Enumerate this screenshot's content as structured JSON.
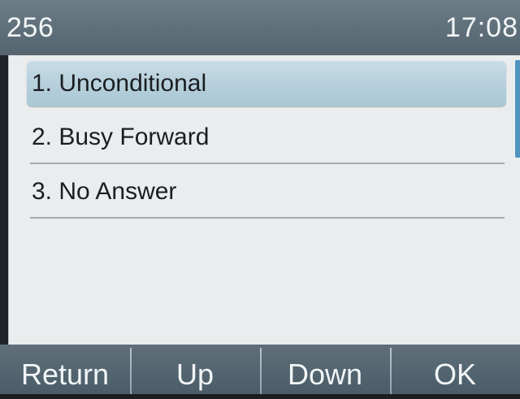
{
  "header": {
    "line_number": "256",
    "time": "17:08"
  },
  "menu": {
    "items": [
      {
        "label": "1. Unconditional",
        "selected": true
      },
      {
        "label": "2. Busy Forward",
        "selected": false
      },
      {
        "label": "3. No Answer",
        "selected": false
      }
    ]
  },
  "softkeys": {
    "return_label": "Return",
    "up_label": "Up",
    "down_label": "Down",
    "ok_label": "OK"
  },
  "colors": {
    "header_bg": "#5f707b",
    "list_bg": "#eaeced",
    "selection": "#b8d1dd",
    "scroll_thumb": "#4e94bf",
    "softkey_bg": "#536570"
  }
}
